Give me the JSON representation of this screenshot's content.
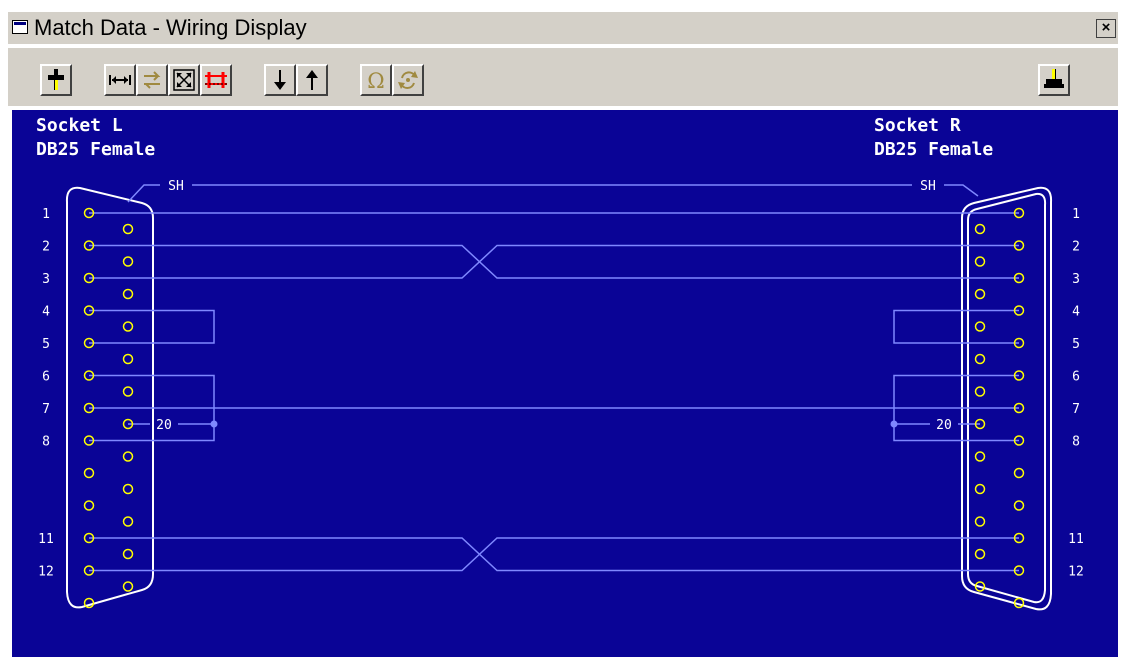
{
  "window": {
    "title": "Match Data - Wiring Display",
    "close_glyph": "×"
  },
  "toolbar": {
    "buttons": [
      {
        "name": "connector-icon",
        "color": "#000000",
        "accent": "#ffff00"
      },
      {
        "name": "fit-width-icon"
      },
      {
        "name": "swap-disabled-icon"
      },
      {
        "name": "expand-icon"
      },
      {
        "name": "cross-links-icon",
        "color": "#ff0000"
      },
      {
        "name": "arrow-down-icon"
      },
      {
        "name": "arrow-up-icon"
      },
      {
        "name": "ohm-icon"
      },
      {
        "name": "refresh-disabled-icon"
      },
      {
        "name": "connector-alt-icon",
        "accent": "#ffff00"
      }
    ]
  },
  "sockets": {
    "left": {
      "name": "Socket L",
      "type": "DB25 Female"
    },
    "right": {
      "name": "Socket R",
      "type": "DB25 Female"
    }
  },
  "wiring": {
    "colors": {
      "background": "#0a0496",
      "wire": "#7f88ff",
      "pin": "#ffff00",
      "shell": "#ffffff"
    },
    "shield_label": "SH",
    "pin_numbers": [
      "1",
      "2",
      "3",
      "4",
      "5",
      "6",
      "7",
      "8",
      "11",
      "12"
    ],
    "ground_label": "20",
    "straight_wires": [
      1,
      7
    ],
    "crossed_pairs": [
      [
        2,
        3
      ],
      [
        11,
        12
      ]
    ],
    "loopbacks": [
      [
        4,
        5
      ]
    ],
    "ground_bridge": {
      "pins": [
        6,
        8
      ],
      "via": 20
    }
  }
}
